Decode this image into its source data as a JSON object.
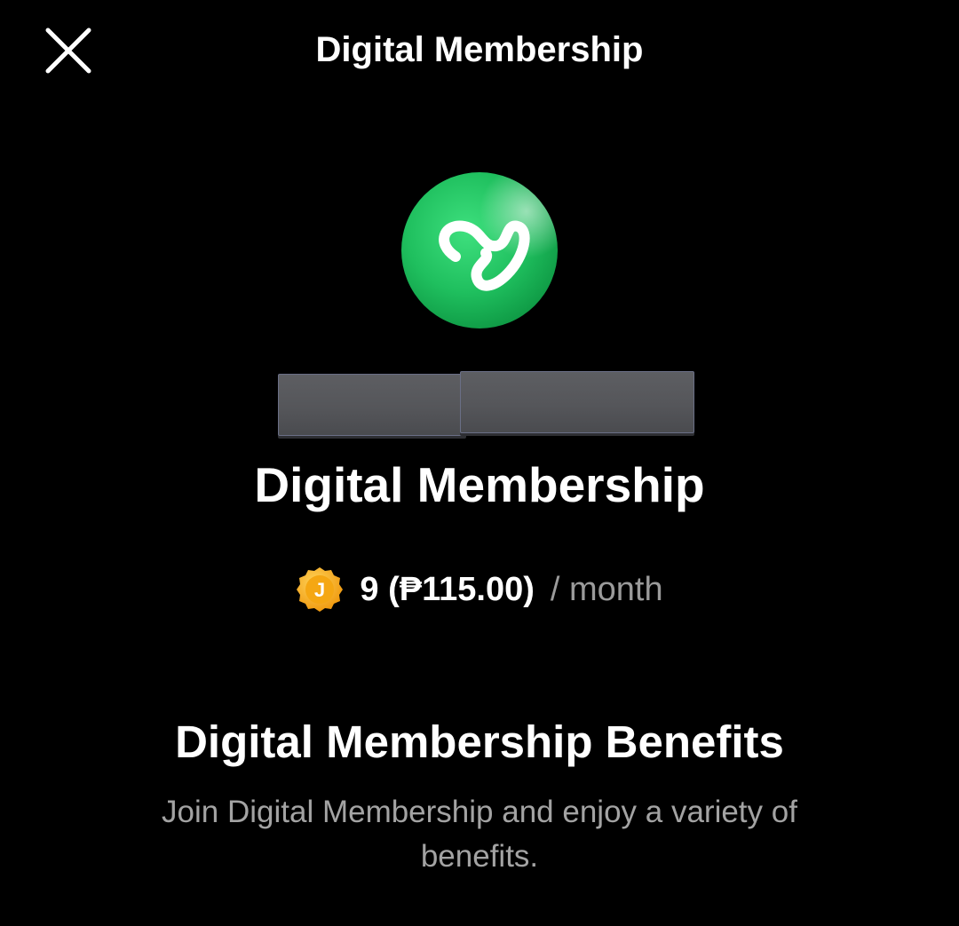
{
  "header": {
    "title": "Digital Membership",
    "close_icon": "close-icon"
  },
  "product": {
    "logo_icon": "membership-logo-icon",
    "logo_color": "#1fbf5e",
    "name": "Digital Membership"
  },
  "price": {
    "coin_icon": "j-coin-icon",
    "coin_letter": "J",
    "coin_color": "#f7b21c",
    "amount_text": "9 (₱115.00)",
    "period_text": "/ month"
  },
  "benefits": {
    "title": "Digital Membership Benefits",
    "description": "Join Digital Membership and enjoy a variety of benefits."
  }
}
